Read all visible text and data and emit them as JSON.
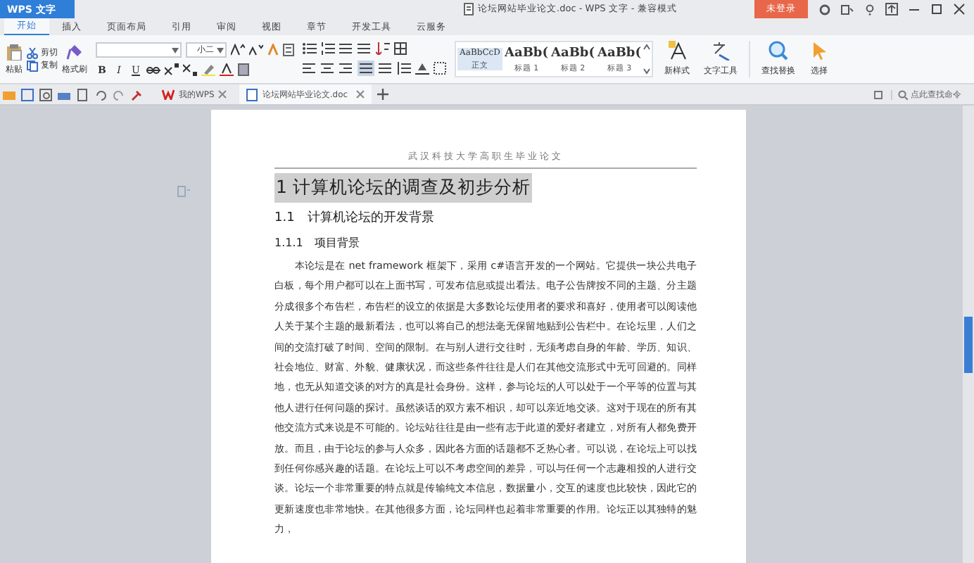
{
  "app_button": {
    "label": "WPS 文字"
  },
  "window": {
    "title": "论坛网站毕业论文.doc - WPS 文字 - 兼容模式"
  },
  "login_button": {
    "label": "未登录"
  },
  "menu_tabs": [
    {
      "label": "开始",
      "selected": true
    },
    {
      "label": "插入",
      "selected": false
    },
    {
      "label": "页面布局",
      "selected": false
    },
    {
      "label": "引用",
      "selected": false
    },
    {
      "label": "审阅",
      "selected": false
    },
    {
      "label": "视图",
      "selected": false
    },
    {
      "label": "章节",
      "selected": false
    },
    {
      "label": "开发工具",
      "selected": false
    },
    {
      "label": "云服务",
      "selected": false
    }
  ],
  "ribbon": {
    "paste": "粘贴",
    "cut": "剪切",
    "copy": "复制",
    "format_painter": "格式刷",
    "font_size": "小二",
    "format_buttons": [
      "B",
      "I",
      "U"
    ],
    "styles": [
      {
        "preview": "AaBbCcD",
        "label": "正文",
        "selected": true
      },
      {
        "preview": "AaBb(",
        "label": "标题 1",
        "selected": false
      },
      {
        "preview": "AaBb(",
        "label": "标题 2",
        "selected": false
      },
      {
        "preview": "AaBb(",
        "label": "标题 3",
        "selected": false
      }
    ],
    "tools": [
      {
        "label": "新样式",
        "kind": "style"
      },
      {
        "label": "文字工具",
        "kind": "text"
      },
      {
        "label": "查找替换",
        "kind": "find"
      },
      {
        "label": "选择",
        "kind": "select"
      }
    ]
  },
  "doc_tabs": [
    {
      "label": "我的WPS",
      "selected": false
    },
    {
      "label": "论坛网站毕业论文.doc",
      "selected": true
    }
  ],
  "command_search": {
    "placeholder": "点此查找命令"
  },
  "document": {
    "header": "武汉科技大学高职生毕业论文",
    "heading_1": "1  计算机论坛的调查及初步分析",
    "heading_2": "1.1　计算机论坛的开发背景",
    "heading_3": "1.1.1　项目背景",
    "paragraph": "本论坛是在 net framework 框架下，采用 c#语言开发的一个网站。它提供一块公共电子白板，每个用户都可以在上面书写，可发布信息或提出看法。电子公告牌按不同的主题、分主题分成很多个布告栏，布告栏的设立的依据是大多数论坛使用者的要求和喜好，使用者可以阅读他人关于某个主题的最新看法，也可以将自己的想法毫无保留地贴到公告栏中。在论坛里，人们之间的交流打破了时间、空间的限制。在与别人进行交往时，无须考虑自身的年龄、学历、知识、社会地位、财富、外貌、健康状况，而这些条件往往是人们在其他交流形式中无可回避的。同样地，也无从知道交谈的对方的真是社会身份。这样，参与论坛的人可以处于一个平等的位置与其他人进行任何问题的探讨。虽然谈话的双方素不相识，却可以亲近地交谈。这对于现在的所有其他交流方式来说是不可能的。论坛站往往是由一些有志于此道的爱好者建立，对所有人都免费开放。而且，由于论坛的参与人众多，因此各方面的话题都不乏热心者。可以说，在论坛上可以找到任何你感兴趣的话题。在论坛上可以不考虑空间的差异，可以与任何一个志趣相投的人进行交谈。论坛一个非常重要的特点就是传输纯文本信息，数据量小，交互的速度也比较快，因此它的更新速度也非常地快。在其他很多方面，论坛同样也起着非常重要的作用。论坛正以其独特的魅力，"
  }
}
